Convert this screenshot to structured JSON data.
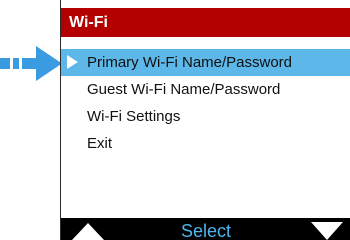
{
  "screen": {
    "title": "Wi-Fi",
    "title_bar_color": "#b30000",
    "highlight_color": "#5db7e8"
  },
  "menu": {
    "selected_index": 0,
    "items": [
      {
        "label": "Primary Wi-Fi Name/Password"
      },
      {
        "label": "Guest Wi-Fi Name/Password"
      },
      {
        "label": "Wi-Fi Settings"
      },
      {
        "label": "Exit"
      }
    ]
  },
  "softkeys": {
    "up_icon": "triangle-up",
    "select_label": "Select",
    "select_color": "#4fb6ee",
    "down_icon": "triangle-down"
  },
  "annotation": {
    "pointer_icon": "arrow-right",
    "pointer_color": "#3a9be0"
  }
}
